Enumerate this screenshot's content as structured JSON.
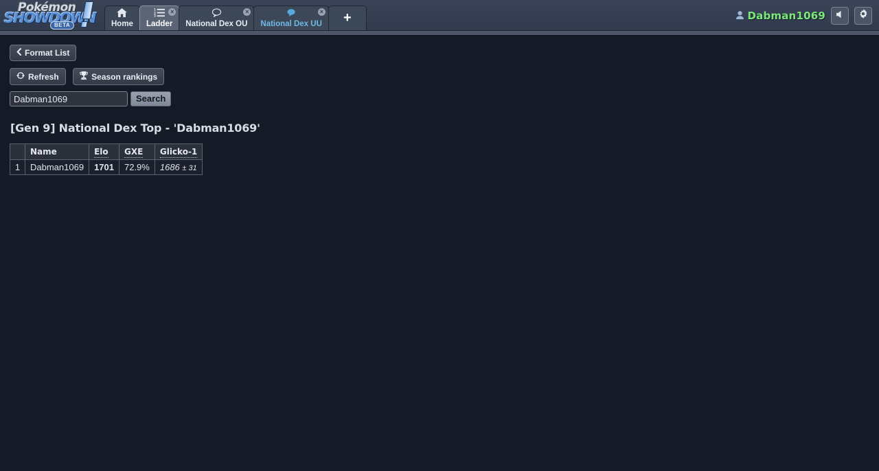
{
  "brand": {
    "name_top": "Pokémon",
    "name_bottom": "SHOWDOWN",
    "badge": "BETA"
  },
  "header": {
    "tabs": [
      {
        "label": "Home",
        "icon": "home-icon",
        "icon_glyph": "⌂",
        "active": false,
        "closable": false,
        "alert": false
      },
      {
        "label": "Ladder",
        "icon": "list-ordered-icon",
        "icon_glyph": "≡",
        "active": true,
        "closable": true,
        "alert": false
      },
      {
        "label": "National Dex OU",
        "icon": "chat-bubble-icon",
        "icon_glyph": "◯",
        "active": false,
        "closable": true,
        "alert": false
      },
      {
        "label": "National Dex UU",
        "icon": "chat-bubble-alert-icon",
        "icon_glyph": "◯",
        "active": false,
        "closable": true,
        "alert": true
      }
    ],
    "new_tab_label": "+",
    "username": "Dabman1069",
    "username_color": "#7ce87c",
    "user_icon": "user-icon",
    "sound_icon": "volume-icon",
    "sound_glyph": "◀",
    "settings_icon": "gear-icon",
    "settings_glyph": "⚙",
    "close_glyph": "×"
  },
  "toolbar": {
    "format_list_label": "Format List",
    "format_list_icon": "chevron-left-icon",
    "format_list_glyph": "‹",
    "refresh_label": "Refresh",
    "refresh_icon": "refresh-icon",
    "refresh_glyph": "↻",
    "season_rankings_label": "Season rankings",
    "season_rankings_icon": "trophy-icon",
    "season_rankings_glyph": "♓",
    "search_value": "Dabman1069",
    "search_placeholder": "Username",
    "search_button_label": "Search"
  },
  "main": {
    "title": "[Gen 9] National Dex Top - 'Dabman1069'",
    "table": {
      "columns": [
        {
          "label": "",
          "tip": false
        },
        {
          "label": "Name",
          "tip": false
        },
        {
          "label": "Elo",
          "tip": true
        },
        {
          "label": "GXE",
          "tip": true
        },
        {
          "label": "Glicko-1",
          "tip": true
        }
      ],
      "rows": [
        {
          "rank": "1",
          "name": "Dabman1069",
          "elo": "1701",
          "gxe": "72.9%",
          "glicko_value": "1686",
          "glicko_dev": "± 31"
        }
      ]
    }
  },
  "colors": {
    "page_bg": "#151a27",
    "header_bg": "#333e51",
    "accent_green": "#7ce87c",
    "accent_blue": "#72b9e8"
  }
}
